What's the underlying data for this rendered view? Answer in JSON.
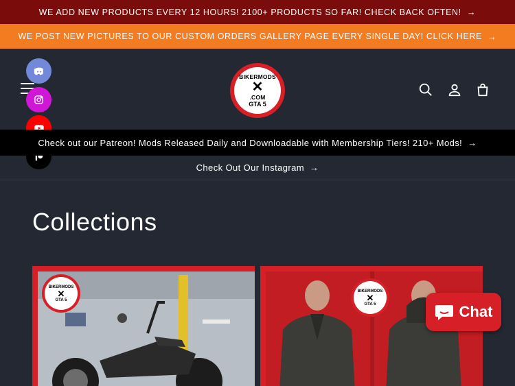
{
  "announcements": {
    "bar1": "WE ADD NEW PRODUCTS EVERY 12 HOURS! 2100+ PRODUCTS SO FAR! CHECK BACK OFTEN!",
    "bar2": "WE POST NEW PICTURES TO OUR CUSTOM ORDERS GALLERY PAGE EVERY SINGLE DAY! CLICK HERE",
    "arrow": "→"
  },
  "logo": {
    "top": "BIKERMODS",
    "middle": ".COM",
    "bottom": "GTA 5"
  },
  "header_icons": [
    "search-icon",
    "account-icon",
    "cart-icon"
  ],
  "social": [
    "discord-icon",
    "instagram-icon",
    "youtube-icon",
    "patreon-icon"
  ],
  "promo": {
    "patreon": "Check out our Patreon! Mods Released Daily and Downloadable with Membership Tiers! 210+ Mods!",
    "instagram": "Check Out Our Instagram"
  },
  "main": {
    "title": "Collections"
  },
  "chat": {
    "label": "Chat"
  },
  "colors": {
    "bar1": "#7a0c0c",
    "bar2": "#f47c20",
    "background": "#232832",
    "accent": "#d61f26",
    "discord": "#7289da",
    "instagram": "#e1306c",
    "youtube": "#ff0000",
    "patreon": "#000000"
  }
}
